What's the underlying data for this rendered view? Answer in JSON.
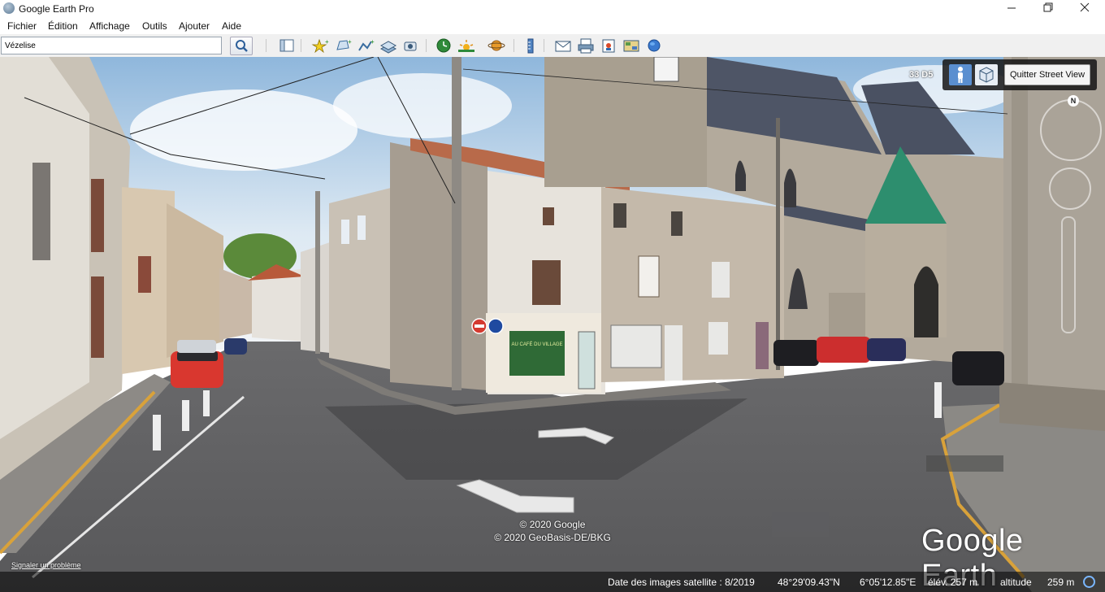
{
  "window": {
    "title": "Google Earth Pro",
    "icon": "google-earth-icon",
    "controls": [
      "minimize-icon",
      "maximize-icon",
      "close-icon"
    ]
  },
  "menu": [
    "Fichier",
    "Édition",
    "Affichage",
    "Outils",
    "Ajouter",
    "Aide"
  ],
  "toolbar": {
    "search_value": "Vézelise",
    "buttons": [
      "sidebar-toggle-icon",
      "placemark-icon",
      "polygon-icon",
      "path-icon",
      "image-overlay-icon",
      "record-tour-icon",
      "historical-imagery-icon",
      "sunlight-icon",
      "planets-icon",
      "ruler-icon",
      "email-icon",
      "print-icon",
      "save-image-icon",
      "view-in-maps-icon",
      "earth-globe-icon"
    ]
  },
  "viewer": {
    "road_label": "33 D5",
    "street_view": {
      "exit_label": "Quitter Street View",
      "accent": "#5a8fd0",
      "compass_north": "N"
    },
    "copyright": [
      "© 2020 Google",
      "© 2020 GeoBasis-DE/BKG"
    ],
    "report_link": "Signaler un problème",
    "brand": "Google Earth",
    "shopfront_sign": "AU CAFÉ DU VILLAGE"
  },
  "status": {
    "imagery_date": "Date des images satellite : 8/2019",
    "latitude": "48°29'09.43\"N",
    "longitude": "6°05'12.85\"E",
    "elevation": "élév.  257 m",
    "altitude": "altitude",
    "altitude_value": "259 m"
  }
}
